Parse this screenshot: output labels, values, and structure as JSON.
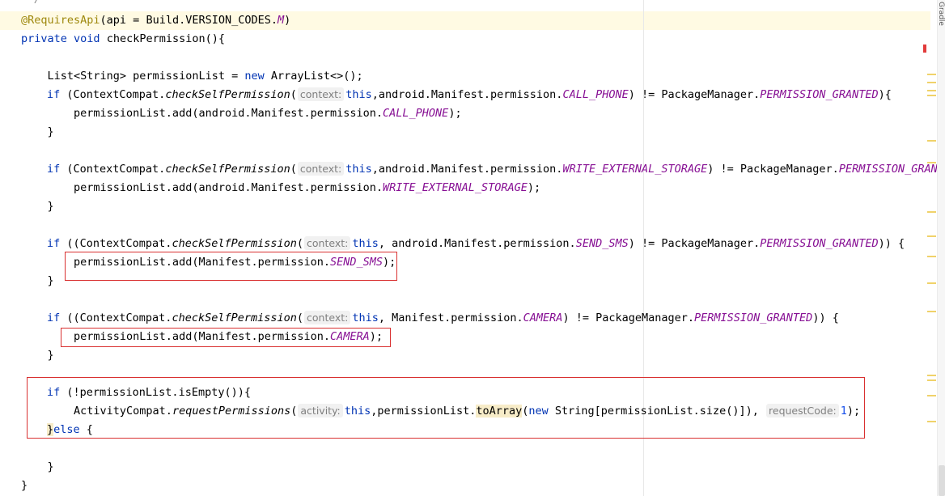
{
  "editor": {
    "comment_tail": " */",
    "side_panel_label": "Gradle",
    "line_annotation": {
      "annotation": "@RequiresApi",
      "open": "(api = Build.VERSION_CODES.",
      "const": "M",
      "close": ")"
    },
    "line_method": {
      "kw_private": "private",
      "kw_void": "void",
      "rest": " checkPermission(){"
    },
    "line_list": {
      "before_new": "    List<String> permissionList = ",
      "kw_new": "new",
      "after_new": " ArrayList<>();"
    },
    "blocks": [
      {
        "if_kw": "if",
        "pre_call": " (ContextCompat.",
        "method": "checkSelfPermission",
        "paren": "(",
        "hint": "context:",
        "this_kw": "this",
        "arg_mid": ",android.Manifest.permission.",
        "perm": "CALL_PHONE",
        "cmp": ") != PackageManager.",
        "granted": "PERMISSION_GRANTED",
        "end": "){",
        "add_pre": "        permissionList.add(android.Manifest.permission.",
        "add_perm": "CALL_PHONE",
        "add_end": ");",
        "close": "    }"
      },
      {
        "if_kw": "if",
        "pre_call": " (ContextCompat.",
        "method": "checkSelfPermission",
        "paren": "(",
        "hint": "context:",
        "this_kw": "this",
        "arg_mid": ",android.Manifest.permission.",
        "perm": "WRITE_EXTERNAL_STORAGE",
        "cmp": ") != PackageManager.",
        "granted": "PERMISSION_GRANT",
        "end": "",
        "add_pre": "        permissionList.add(android.Manifest.permission.",
        "add_perm": "WRITE_EXTERNAL_STORAGE",
        "add_end": ");",
        "close": "    }"
      },
      {
        "if_kw": "if",
        "pre_call": " ((ContextCompat.",
        "method": "checkSelfPermission",
        "paren": "(",
        "hint": "context:",
        "this_kw": "this",
        "arg_mid": ", android.Manifest.permission.",
        "perm": "SEND_SMS",
        "cmp": ") != PackageManager.",
        "granted": "PERMISSION_GRANTED",
        "end": ")) {",
        "add_pre": "        permissionList.add(Manifest.permission.",
        "add_perm": "SEND_SMS",
        "add_end": ");",
        "close": "    }"
      },
      {
        "if_kw": "if",
        "pre_call": " ((ContextCompat.",
        "method": "checkSelfPermission",
        "paren": "(",
        "hint": "context:",
        "this_kw": "this",
        "arg_mid": ", Manifest.permission.",
        "perm": "CAMERA",
        "cmp": ") != PackageManager.",
        "granted": "PERMISSION_GRANTED",
        "end": ")) {",
        "add_pre": "        permissionList.add(Manifest.permission.",
        "add_perm": "CAMERA",
        "add_end": ");",
        "close": "    }"
      }
    ],
    "request_block": {
      "if_kw": "if",
      "cond": " (!permissionList.isEmpty()){",
      "call_pre": "        ActivityCompat.",
      "call_method": "requestPermissions",
      "call_paren": "(",
      "hint_activity": "activity:",
      "this_kw": "this",
      "list_part": ",permissionList.",
      "to_array": "toArray",
      "paren2": "(",
      "kw_new": "new",
      "array_part": " String[permissionList.size()]),",
      "hint_request": "requestCode:",
      "num": "1",
      "call_end": ");",
      "else_open": "}",
      "else_kw": "else",
      "else_brace": " {",
      "inner_close": "    }",
      "outer_close": "}"
    }
  },
  "colors": {
    "keyword": "#0033b3",
    "annotation": "#9e880d",
    "constant": "#871094",
    "hint_text": "#808080",
    "box_red": "#d93030",
    "current_line": "#fffae3"
  }
}
